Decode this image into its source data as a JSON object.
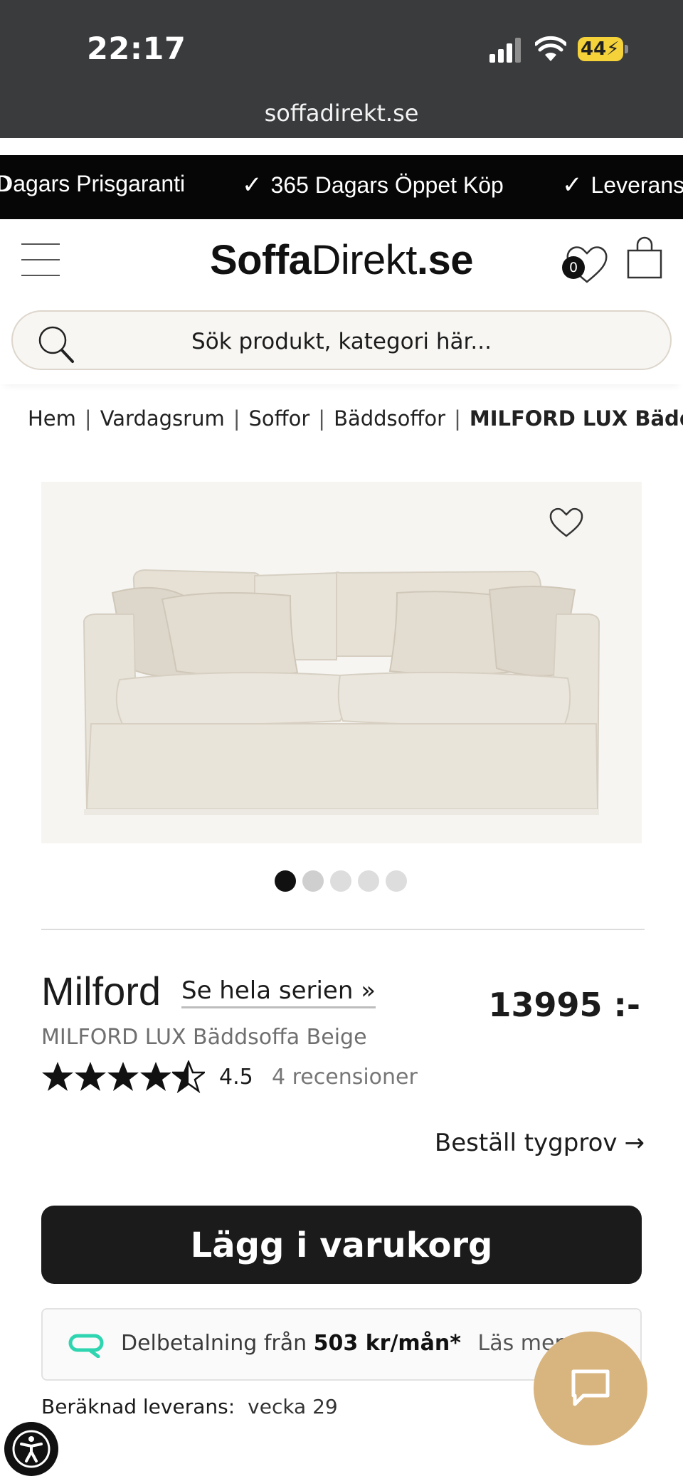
{
  "status_bar": {
    "time": "22:17",
    "battery": "44",
    "url": "soffadirekt.se"
  },
  "promo_bar": {
    "items": [
      "Dagars Prisgaranti",
      "365 Dagars Öppet Köp",
      "Leverans"
    ]
  },
  "header": {
    "logo_part1": "Soffa",
    "logo_part2": "Direkt",
    "logo_part3": ".se",
    "wishlist_count": "0",
    "search_placeholder": "Sök produkt, kategori här..."
  },
  "breadcrumb": {
    "items": [
      "Hem",
      "Vardagsrum",
      "Soffor",
      "Bäddsoffor"
    ],
    "current": "MILFORD LUX Bäddsoffa Beige"
  },
  "gallery": {
    "dot_count": 5,
    "active_dot": 0
  },
  "product": {
    "name": "Milford",
    "series_link": "Se hela serien »",
    "price": "13995 :-",
    "subtitle": "MILFORD LUX Bäddsoffa Beige",
    "rating": "4.5",
    "rating_value": 4.5,
    "review_count": "4 recensioner",
    "fabric_sample": "Beställ tygprov",
    "add_to_cart": "Lägg i varukorg"
  },
  "installment": {
    "prefix": "Delbetalning från",
    "amount": "503 kr/mån*",
    "more": "Läs mer"
  },
  "delivery": {
    "label": "Beräknad leverans:",
    "value": "vecka 29"
  },
  "colors": {
    "status_bar": "#3a3b3d",
    "promo_bar": "#060606",
    "primary_button": "#1b1b1b",
    "chat_button": "#d8b47e",
    "installment_icon": "#2fd5b0"
  }
}
